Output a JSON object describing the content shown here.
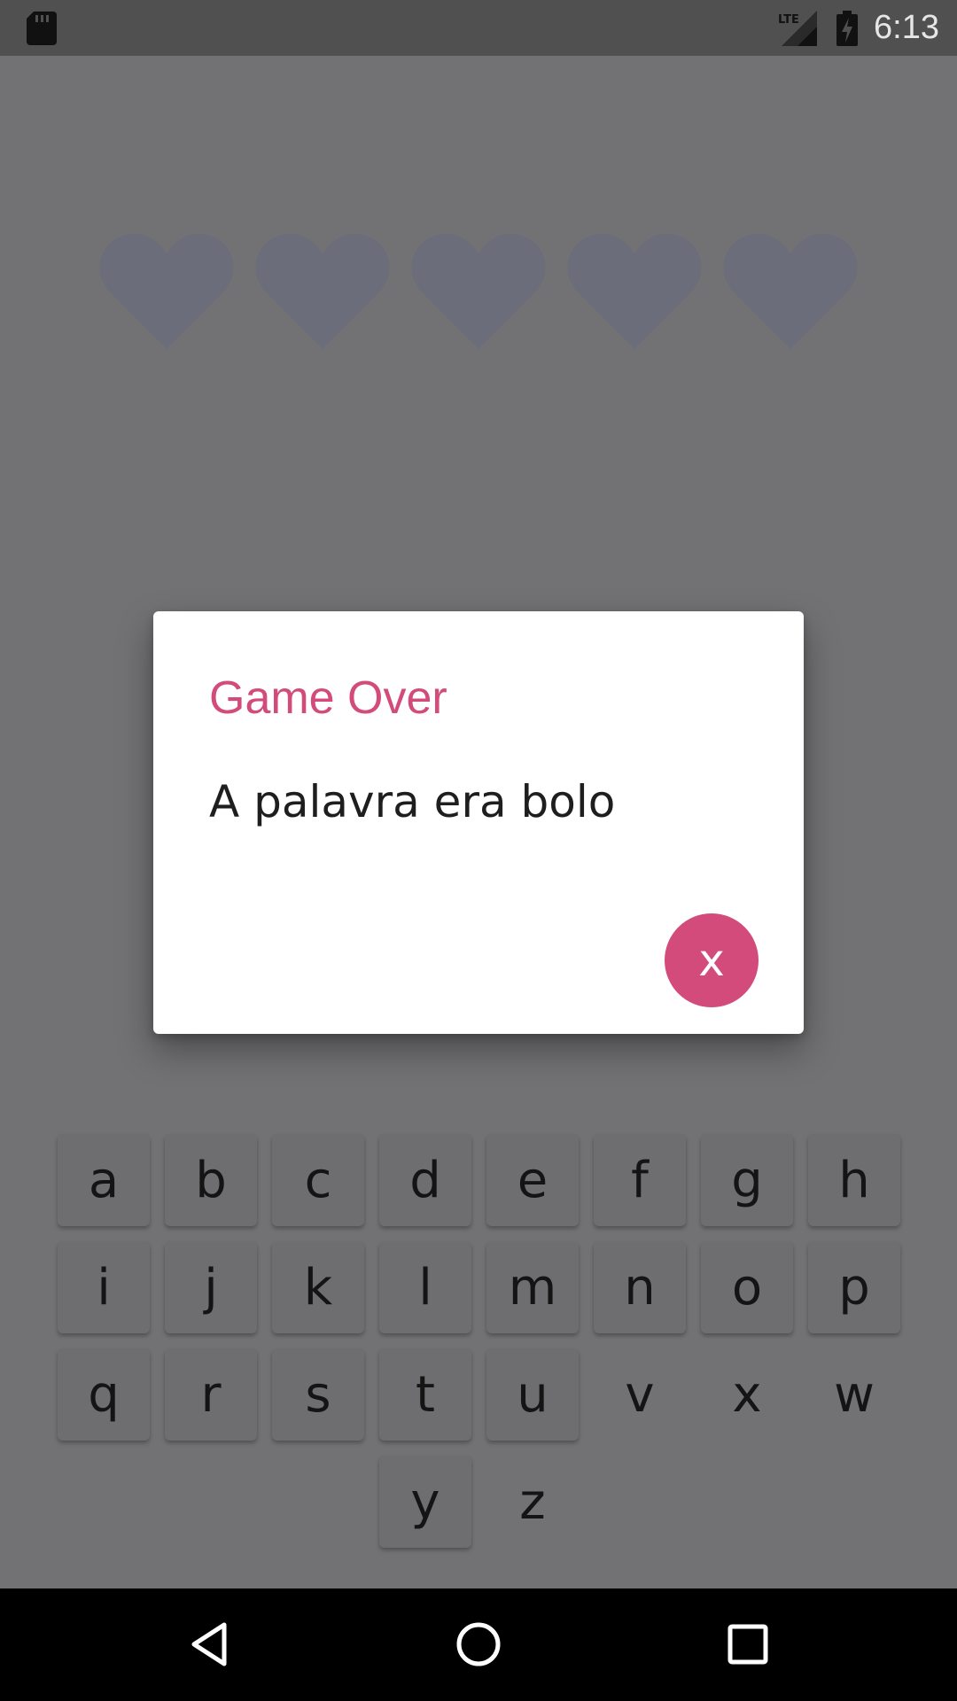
{
  "status_bar": {
    "time": "6:13",
    "network": "LTE",
    "icons": [
      "sd-card-icon",
      "signal-icon",
      "battery-charging-icon"
    ]
  },
  "lives": {
    "total": 5,
    "icon": "heart-icon",
    "color": "#6b6d7a"
  },
  "dialog": {
    "title": "Game Over",
    "message": "A palavra era bolo",
    "close_label": "x",
    "accent_color": "#d24b7b"
  },
  "keyboard": {
    "rows": [
      [
        {
          "label": "a",
          "used": false
        },
        {
          "label": "b",
          "used": false
        },
        {
          "label": "c",
          "used": false
        },
        {
          "label": "d",
          "used": false
        },
        {
          "label": "e",
          "used": false
        },
        {
          "label": "f",
          "used": false
        },
        {
          "label": "g",
          "used": false
        },
        {
          "label": "h",
          "used": false
        }
      ],
      [
        {
          "label": "i",
          "used": false
        },
        {
          "label": "j",
          "used": false
        },
        {
          "label": "k",
          "used": false
        },
        {
          "label": "l",
          "used": false
        },
        {
          "label": "m",
          "used": false
        },
        {
          "label": "n",
          "used": false
        },
        {
          "label": "o",
          "used": false
        },
        {
          "label": "p",
          "used": false
        }
      ],
      [
        {
          "label": "q",
          "used": false
        },
        {
          "label": "r",
          "used": false
        },
        {
          "label": "s",
          "used": false
        },
        {
          "label": "t",
          "used": false
        },
        {
          "label": "u",
          "used": false
        },
        {
          "label": "v",
          "used": true
        },
        {
          "label": "x",
          "used": true
        },
        {
          "label": "w",
          "used": true
        }
      ],
      [
        {
          "label": "y",
          "used": false
        },
        {
          "label": "z",
          "used": true
        }
      ]
    ]
  },
  "nav_bar": {
    "icons": [
      "back-icon",
      "home-icon",
      "recents-icon"
    ]
  }
}
